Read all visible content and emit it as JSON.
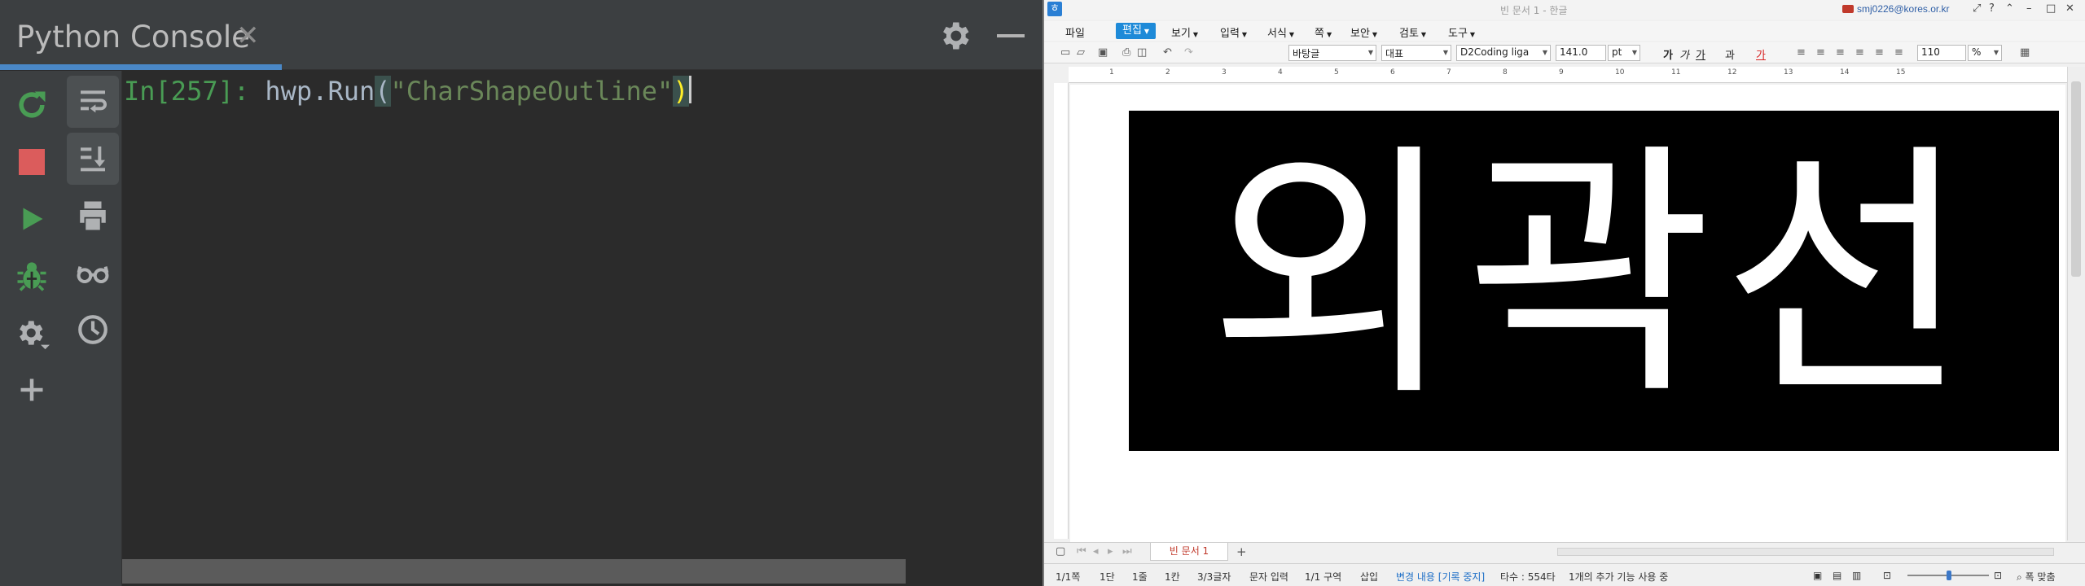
{
  "console": {
    "title": "Python Console",
    "close_glyph": "✕",
    "prompt": "In[257]: ",
    "code_before": "hwp.Run",
    "open_paren": "(",
    "string": "\"CharShapeOutline\"",
    "close_paren": ")",
    "toolbar_left_icons": [
      "rerun-icon",
      "stop-icon",
      "run-icon",
      "debug-icon",
      "settings-icon",
      "add-icon"
    ],
    "toolbar_right_icons": [
      "soft-wrap-icon",
      "scroll-to-end-icon",
      "print-icon",
      "show-variables-icon",
      "history-icon"
    ],
    "colors": {
      "prompt": "#499c54",
      "string": "#6a8759",
      "accent": "#4a88c7",
      "stop": "#db5c5c",
      "run": "#499c54"
    }
  },
  "hwp": {
    "window_title": "빈 문서 1 - 한글",
    "user": "smj0226@kores.or.kr",
    "menus": [
      {
        "label": "파일",
        "dropdown": false,
        "active": false
      },
      {
        "label": "편집",
        "dropdown": true,
        "active": true
      },
      {
        "label": "보기",
        "dropdown": true,
        "active": false
      },
      {
        "label": "입력",
        "dropdown": true,
        "active": false
      },
      {
        "label": "서식",
        "dropdown": true,
        "active": false
      },
      {
        "label": "쪽",
        "dropdown": true,
        "active": false
      },
      {
        "label": "보안",
        "dropdown": true,
        "active": false
      },
      {
        "label": "검토",
        "dropdown": true,
        "active": false
      },
      {
        "label": "도구",
        "dropdown": true,
        "active": false
      }
    ],
    "style_select": "바탕글",
    "lang_select": "대표",
    "font_select": "D2Coding liga",
    "font_size": "141.0",
    "font_unit": "pt",
    "zoom_select": "110",
    "zoom_unit": "%",
    "ruler_numbers": [
      "1",
      "2",
      "3",
      "4",
      "5",
      "6",
      "7",
      "8",
      "9",
      "10",
      "11",
      "12",
      "13",
      "14",
      "15"
    ],
    "document_text": "외곽선",
    "doc_tab": "빈 문서 1",
    "status": {
      "page": "1/1쪽",
      "section": "1단",
      "line": "1줄",
      "column": "1칸",
      "chars": "3/3글자",
      "mode": "문자 입력",
      "area": "1/1 구역",
      "insert": "삽입",
      "track": "변경 내용 [기록 중지]",
      "typing": "타수 : 554타",
      "addons": "1개의 추가 기능 사용 중",
      "fit": "폭 맞춤"
    }
  }
}
